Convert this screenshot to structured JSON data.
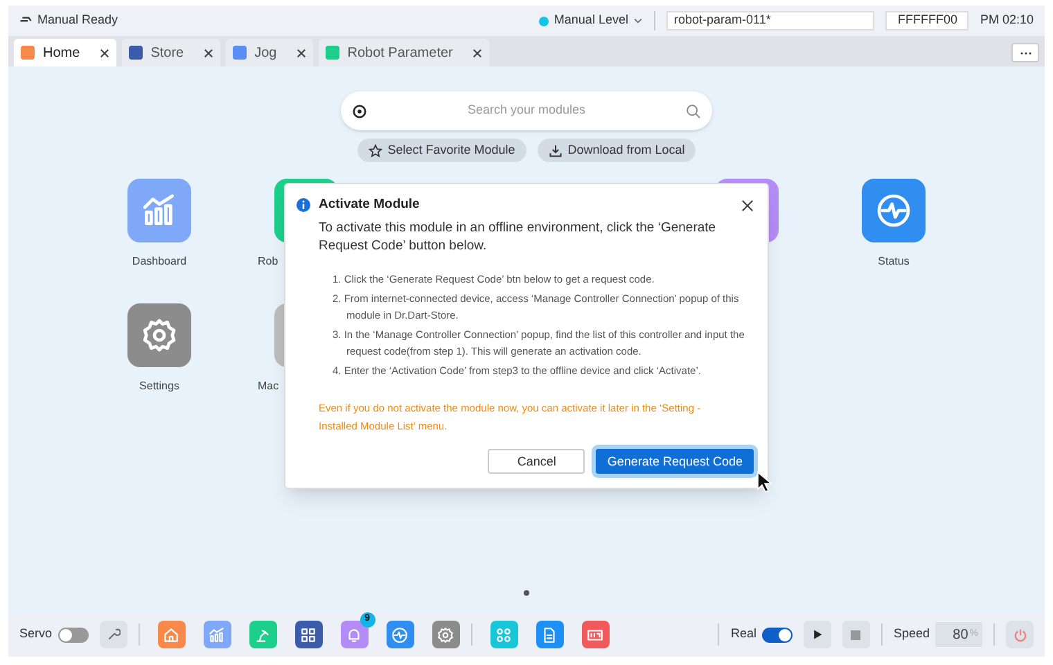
{
  "top_bar": {
    "state": "Manual Ready",
    "mode": "Manual Level",
    "program": "robot-param-011*",
    "code": "FFFFFF00",
    "time": "PM 02:10"
  },
  "tabs": [
    {
      "label": "Home",
      "selected": true,
      "color": "#f7894a"
    },
    {
      "label": "Store",
      "selected": false,
      "color": "#3b5bab"
    },
    {
      "label": "Jog",
      "selected": false,
      "color": "#5b8ef5"
    },
    {
      "label": "Robot Parameter",
      "selected": false,
      "color": "#1ccf8a"
    }
  ],
  "search": {
    "placeholder": "Search your modules"
  },
  "actions": [
    {
      "kind": "star",
      "label": "Select Favorite Module"
    },
    {
      "kind": "download",
      "label": "Download from Local"
    }
  ],
  "modules": [
    {
      "kind": "chart",
      "label": "Dashboard",
      "color": "#7fa8f8"
    },
    {
      "kind": "partial",
      "label": "Rob",
      "color": "#1ccf8a"
    },
    {
      "kind": "hidden"
    },
    {
      "kind": "hidden"
    },
    {
      "kind": "blank",
      "color": "#b48cf5"
    },
    {
      "kind": "pulse",
      "label": "Status",
      "color": "#2f8ef0"
    },
    {
      "kind": "gear",
      "label": "Settings",
      "color": "#8c8c8c"
    },
    {
      "kind": "partial",
      "label": "Mac",
      "color": "#bdbdbd"
    }
  ],
  "dialog": {
    "title": "Activate Module",
    "intro": "To activate this module in an offline environment, click the ‘Generate Request Code’ button below.",
    "steps": [
      "1. Click the ‘Generate Request Code’ btn below to get a request code.",
      "2. From internet-connected device, access  ‘Manage Controller Connection’ popup of this module in Dr.Dart-Store.",
      "3. In the  ‘Manage Controller Connection’ popup, find the list of this controller and input the request code(from step 1). This will generate an activation code.",
      "4. Enter the ‘Activation Code’ from step3 to the offline device and click ‘Activate’."
    ],
    "note": "Even if you do not activate the module now, you can activate it later in the ‘Setting - Installed Module List’ menu.",
    "buttons": [
      {
        "kind": "secondary",
        "label": "Cancel"
      },
      {
        "kind": "primary",
        "label": "Generate Request Code"
      }
    ]
  },
  "dock": {
    "servo": {
      "label": "Servo",
      "on": false
    },
    "apps": [
      {
        "kind": "home",
        "color": "#f7894a"
      },
      {
        "kind": "chart",
        "color": "#7fa8f8"
      },
      {
        "kind": "robot",
        "color": "#1ccf8a"
      },
      {
        "kind": "grid",
        "color": "#3b5bab"
      },
      {
        "kind": "bell",
        "color": "#b48cf5",
        "badge": "9"
      },
      {
        "kind": "pulse",
        "color": "#2f8ef0"
      },
      {
        "kind": "gear",
        "color": "#8c8c8c"
      },
      {
        "kind": "sep"
      },
      {
        "kind": "apps",
        "color": "#19c6d8"
      },
      {
        "kind": "doc",
        "color": "#1e90f5"
      },
      {
        "kind": "panel",
        "color": "#f05a5a"
      }
    ],
    "real": {
      "label": "Real",
      "on": true
    },
    "speed": {
      "label": "Speed",
      "value": "80",
      "unit": "%"
    }
  }
}
